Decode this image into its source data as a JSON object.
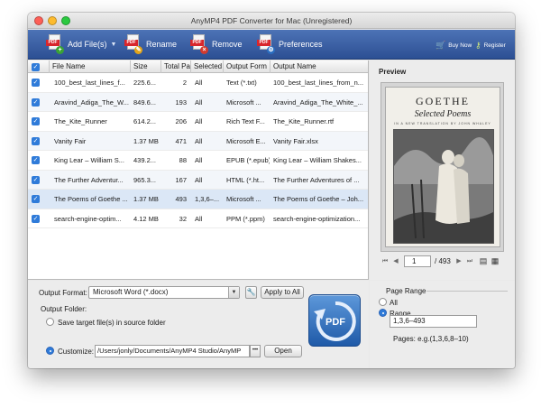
{
  "window": {
    "title": "AnyMP4 PDF Converter for Mac (Unregistered)"
  },
  "toolbar": {
    "add_files": "Add File(s)",
    "rename": "Rename",
    "remove": "Remove",
    "preferences": "Preferences",
    "buy_now": "Buy Now",
    "register": "Register"
  },
  "table": {
    "headers": [
      "File Name",
      "Size",
      "Total Pa",
      "Selected",
      "Output Form",
      "Output Name"
    ],
    "rows": [
      {
        "name": "100_best_last_lines_f...",
        "size": "225.6...",
        "pages": "2",
        "selected": "All",
        "format": "Text (*.txt)",
        "output": "100_best_last_lines_from_n..."
      },
      {
        "name": "Aravind_Adiga_The_W...",
        "size": "849.6...",
        "pages": "193",
        "selected": "All",
        "format": "Microsoft ...",
        "output": "Aravind_Adiga_The_White_..."
      },
      {
        "name": "The_Kite_Runner",
        "size": "614.2...",
        "pages": "206",
        "selected": "All",
        "format": "Rich Text F...",
        "output": "The_Kite_Runner.rtf"
      },
      {
        "name": "Vanity Fair",
        "size": "1.37 MB",
        "pages": "471",
        "selected": "All",
        "format": "Microsoft E...",
        "output": "Vanity Fair.xlsx"
      },
      {
        "name": "King Lear – William S...",
        "size": "439.2...",
        "pages": "88",
        "selected": "All",
        "format": "EPUB (*.epub)",
        "output": "King Lear – William Shakes..."
      },
      {
        "name": "The Further Adventur...",
        "size": "965.3...",
        "pages": "167",
        "selected": "All",
        "format": "HTML (*.ht...",
        "output": "The Further Adventures of ..."
      },
      {
        "name": "The Poems of Goethe ...",
        "size": "1.37 MB",
        "pages": "493",
        "selected": "1,3,6–...",
        "format": "Microsoft ...",
        "output": "The Poems of Goethe – Joh..."
      },
      {
        "name": "search-engine-optim...",
        "size": "4.12 MB",
        "pages": "32",
        "selected": "All",
        "format": "PPM (*.ppm)",
        "output": "search-engine-optimization..."
      }
    ]
  },
  "preview": {
    "label": "Preview",
    "book_title": "GOETHE",
    "book_subtitle": "Selected Poems",
    "book_tagline": "IN A NEW TRANSLATION BY JOHN WHALEY",
    "page_current": "1",
    "page_total": "/ 493"
  },
  "output": {
    "format_label": "Output Format:",
    "format_value": "Microsoft Word (*.docx)",
    "apply_all": "Apply to All",
    "folder_label": "Output Folder:",
    "save_source": "Save target file(s) in source folder",
    "customize": "Customize:",
    "path": "/Users/jonly/Documents/AnyMP4 Studio/AnyMP",
    "dots": "•••",
    "open": "Open",
    "convert_label": "PDF"
  },
  "page_range": {
    "label": "Page Range",
    "all": "All",
    "range": "Range",
    "range_value": "1,3,6–493",
    "hint": "Pages: e.g.(1,3,6,8–10)"
  },
  "colors": {
    "toolbar": "#2c4f93",
    "accent": "#2f7bd9",
    "selected_row": "#dbe7f6"
  }
}
